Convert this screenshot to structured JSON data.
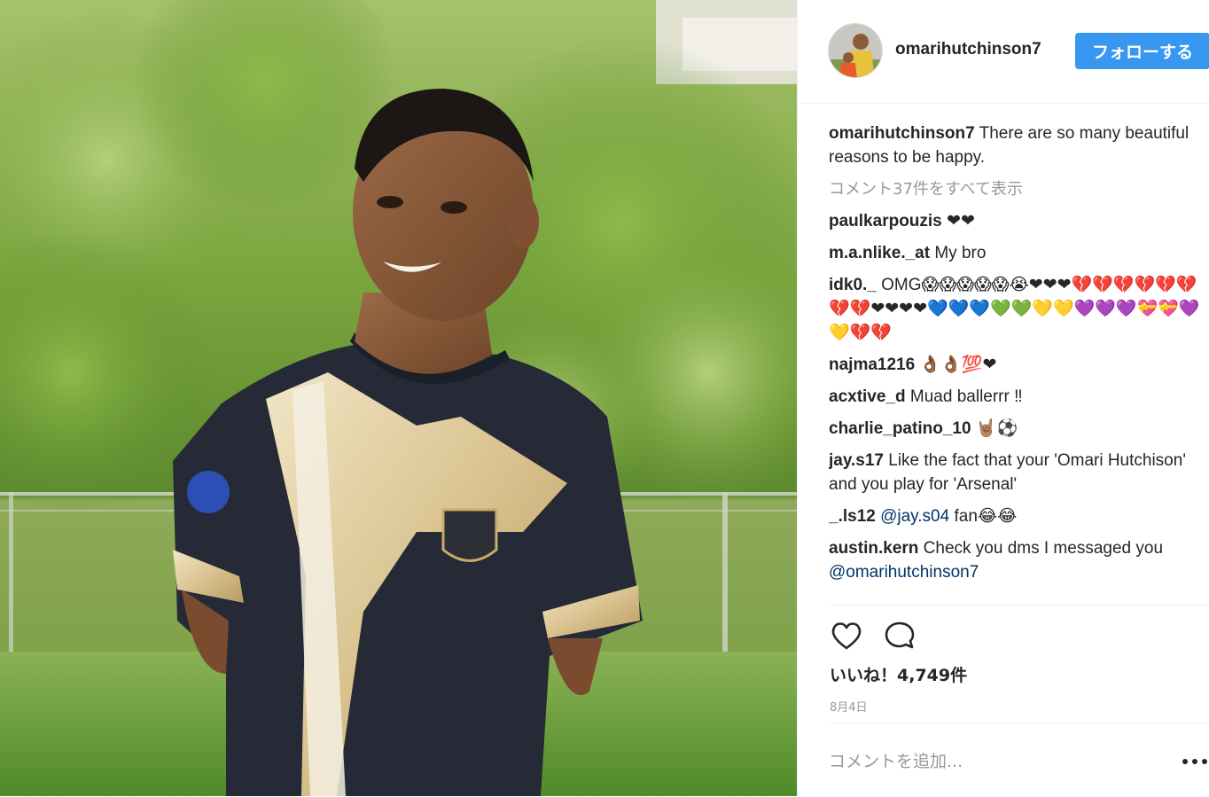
{
  "post": {
    "photo_alt": "",
    "author": "omarihutchinson7",
    "follow_label": "フォローする",
    "caption": {
      "user": "omarihutchinson7",
      "text": "There are so many beautiful reasons to be happy."
    },
    "view_all_comments": "コメント37件をすべて表示",
    "comments": [
      {
        "user": "paulkarpouzis",
        "text": "❤❤"
      },
      {
        "user": "m.a.nlike._at",
        "text": "My bro"
      },
      {
        "user": "idk0._",
        "text": "OMG😱😱😱😱😱😭❤❤❤💔💔💔💔💔💔💔💔❤❤❤❤💙💙💙💚💚💛💛💜💜💜💝💝💜💛💔💔"
      },
      {
        "user": "najma1216",
        "text": "👌🏾👌🏾💯❤"
      },
      {
        "user": "acxtive_d",
        "text": "Muad ballerrr ‼"
      },
      {
        "user": "charlie_patino_10",
        "text": "🤘🏽⚽"
      },
      {
        "user": "jay.s17",
        "text": "Like the fact that your 'Omari Hutchison' and you play for 'Arsenal'"
      },
      {
        "user": "_.ls12",
        "mention": "@jay.s04",
        "text": "fan😂😂"
      },
      {
        "user": "austin.kern",
        "text": "Check you dms I messaged you",
        "mention": "@omarihutchinson7"
      }
    ],
    "likes_label": "いいね！4,749件",
    "date": "8月4日",
    "comment_placeholder": "コメントを追加..."
  },
  "icons": {
    "like": "heart-outline-icon",
    "comment": "speech-bubble-icon",
    "more": "ellipsis-icon"
  },
  "colors": {
    "follow_button": "#3897f0",
    "mention": "#003569",
    "muted_text": "#999999"
  }
}
